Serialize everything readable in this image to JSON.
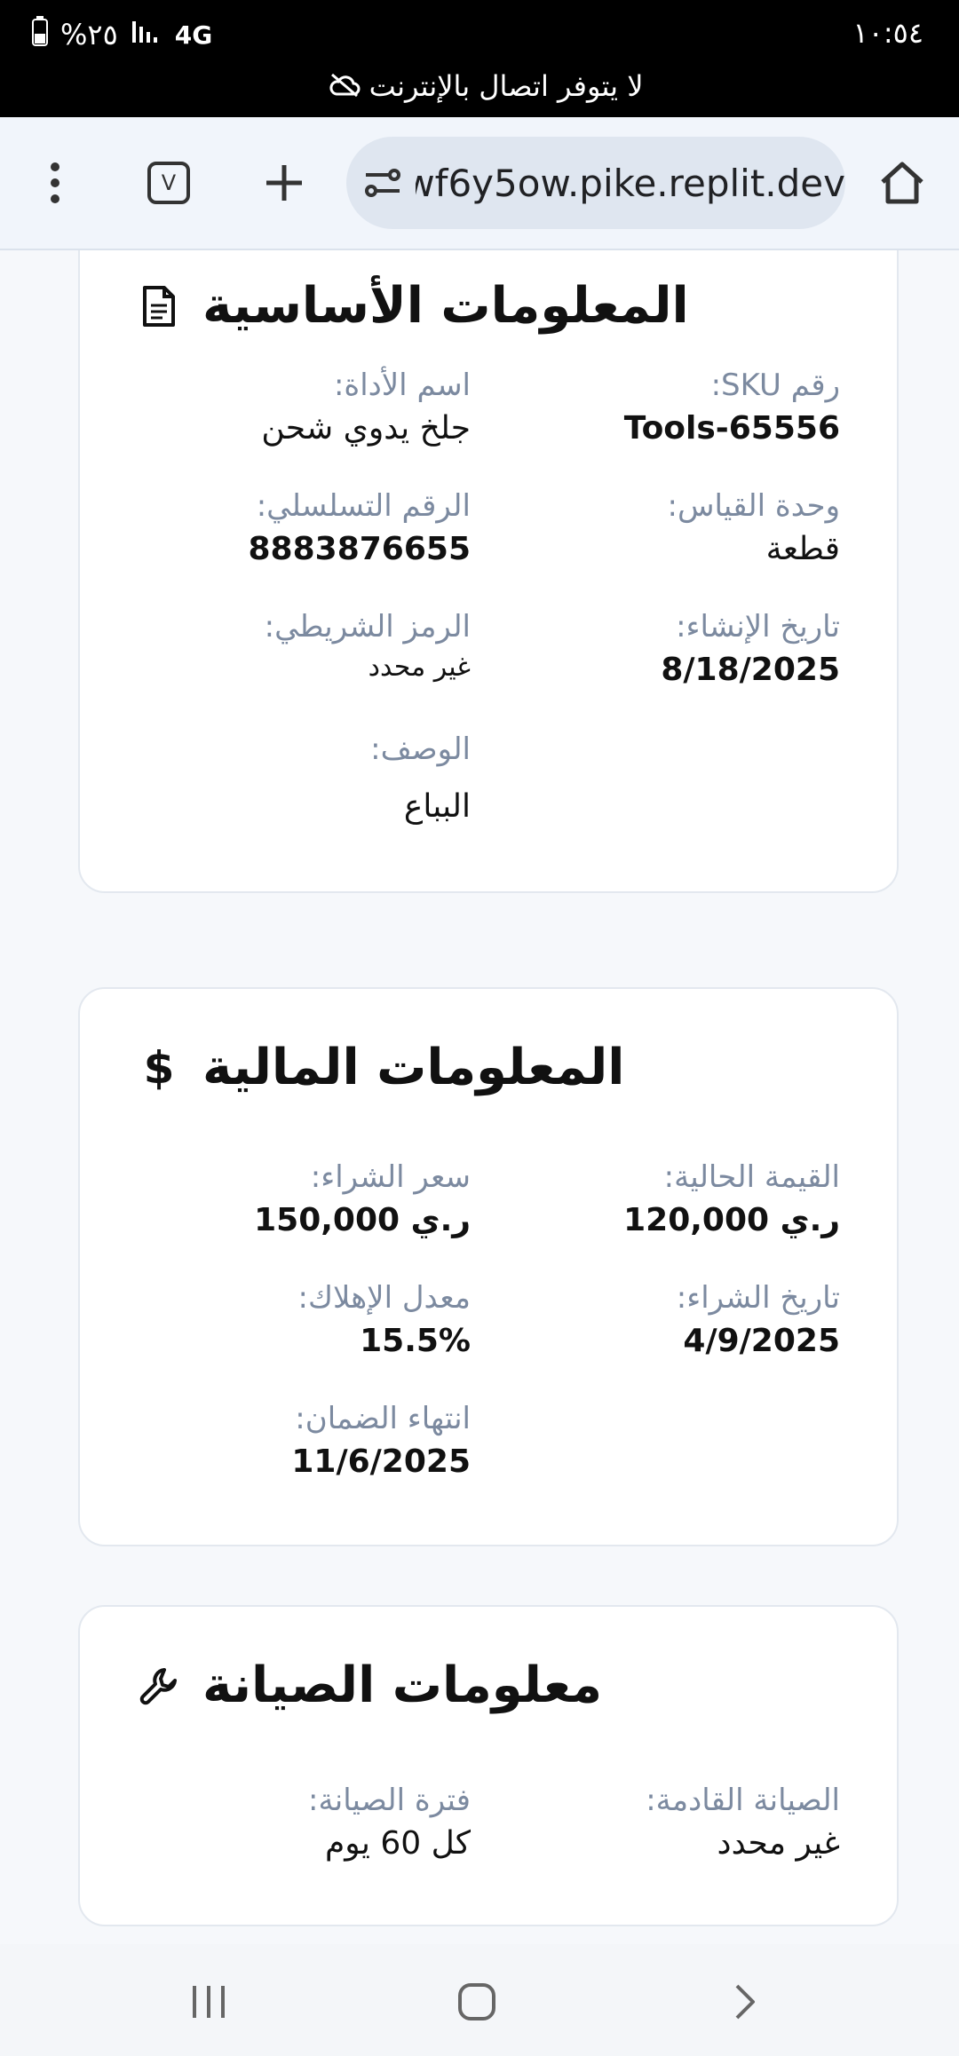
{
  "status": {
    "time": "١٠:٥٤",
    "battery": "%٢٥",
    "network": "4G",
    "offline_message": "لا يتوفر اتصال بالإنترنت"
  },
  "browser": {
    "url": "wf6y5ow.pike.replit.dev",
    "tab_count": "V"
  },
  "basic_info": {
    "title": "المعلومات الأساسية",
    "tool_name_label": "اسم الأداة:",
    "tool_name": "جلخ يدوي شحن",
    "sku_label": "رقم SKU:",
    "sku": "Tools-65556",
    "serial_label": "الرقم التسلسلي:",
    "serial": "8883876655",
    "unit_label": "وحدة القياس:",
    "unit": "قطعة",
    "barcode_label": "الرمز الشريطي:",
    "barcode": "غير محدد",
    "created_label": "تاريخ الإنشاء:",
    "created": "8/18/2025",
    "description_label": "الوصف:",
    "description": "البباع"
  },
  "financial_info": {
    "title": "المعلومات المالية",
    "purchase_price_label": "سعر الشراء:",
    "purchase_price": "ر.ي 150,000",
    "current_value_label": "القيمة الحالية:",
    "current_value": "ر.ي 120,000",
    "depreciation_label": "معدل الإهلاك:",
    "depreciation": "15.5%",
    "purchase_date_label": "تاريخ الشراء:",
    "purchase_date": "4/9/2025",
    "warranty_label": "انتهاء الضمان:",
    "warranty": "11/6/2025"
  },
  "maintenance_info": {
    "title": "معلومات الصيانة",
    "interval_label": "فترة الصيانة:",
    "interval": "كل 60 يوم",
    "next_label": "الصيانة القادمة:",
    "next": "غير محدد"
  }
}
